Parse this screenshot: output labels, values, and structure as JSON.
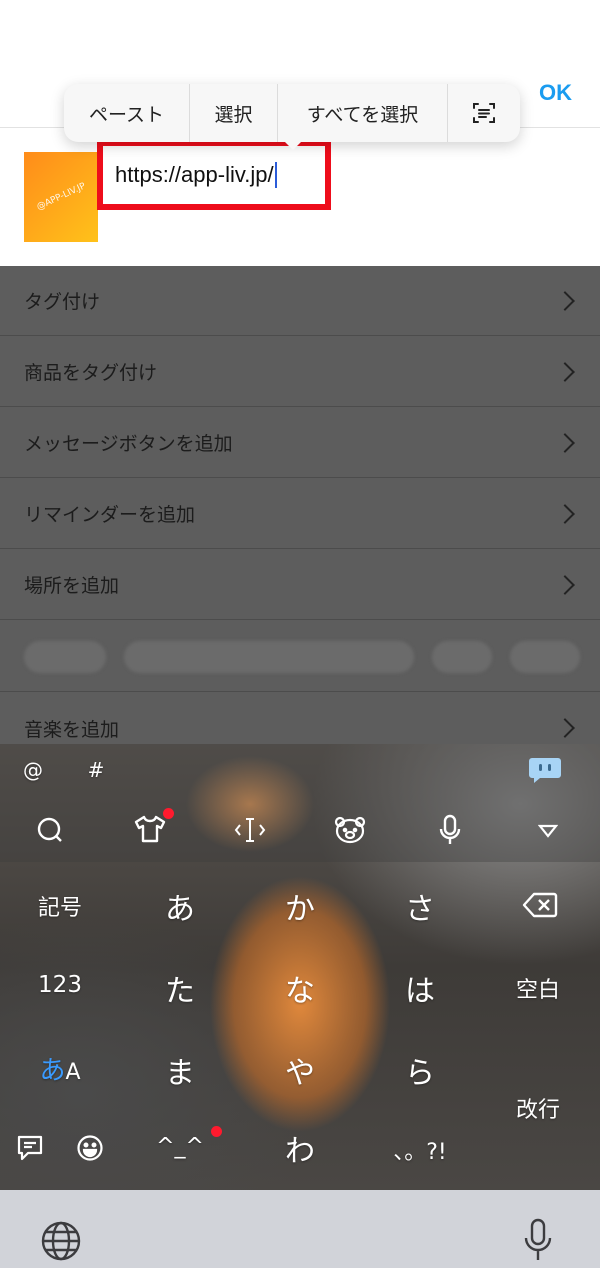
{
  "header": {
    "ok_label": "OK"
  },
  "edit_menu": {
    "paste": "ペースト",
    "select": "選択",
    "select_all": "すべてを選択",
    "scan_icon": "scan-text-icon"
  },
  "composer": {
    "url_text": "https://app-liv.jp/",
    "thumbnail_text": "@APP-LIV.JP"
  },
  "list": {
    "items": [
      {
        "label": "タグ付け"
      },
      {
        "label": "商品をタグ付け"
      },
      {
        "label": "メッセージボタンを追加"
      },
      {
        "label": "リマインダーを追加"
      },
      {
        "label": "場所を追加"
      }
    ],
    "music": {
      "label": "音楽を追加"
    }
  },
  "keyboard": {
    "at": "@",
    "hash": "#",
    "keys": {
      "kigou": "記号",
      "a": "あ",
      "ka": "か",
      "sa": "さ",
      "num": "123",
      "ta": "た",
      "na": "な",
      "ha": "は",
      "space": "空白",
      "mode_hira": "あ",
      "mode_latin": "A",
      "ma": "ま",
      "ya": "や",
      "ra": "ら",
      "enter": "改行",
      "kaomoji": "^_^",
      "wa": "わ",
      "punct": "、。?!"
    },
    "accent": "#ff1a2e",
    "mode_color": "#3a9bff"
  },
  "colors": {
    "link": "#1a9cf0",
    "highlight": "#ee0d1b"
  }
}
